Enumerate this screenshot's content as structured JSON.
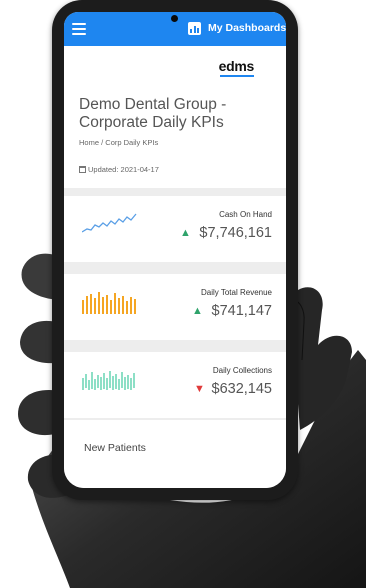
{
  "topbar": {
    "nav_label": "My Dashboards"
  },
  "header": {
    "logo": "edms",
    "title": "Demo Dental Group - Corporate Daily KPIs",
    "breadcrumb": {
      "home": "Home",
      "separator": "/",
      "current": "Corp Daily KPIs"
    },
    "updated": "Updated: 2021-04-17"
  },
  "kpis": [
    {
      "label": "Cash On Hand",
      "value": "$7,746,161",
      "trend": "up",
      "trend_glyph": "▲",
      "spark_type": "line",
      "color": "#5a9fe6"
    },
    {
      "label": "Daily Total Revenue",
      "value": "$741,147",
      "trend": "up",
      "trend_glyph": "▲",
      "spark_type": "bar",
      "color": "#f5a623"
    },
    {
      "label": "Daily Collections",
      "value": "$632,145",
      "trend": "down",
      "trend_glyph": "▼",
      "spark_type": "area",
      "color": "#41c9a0"
    }
  ],
  "next_section": {
    "title": "New Patients"
  },
  "colors": {
    "brand": "#1e86f0",
    "up": "#2fa36b",
    "down": "#e03a3a"
  }
}
